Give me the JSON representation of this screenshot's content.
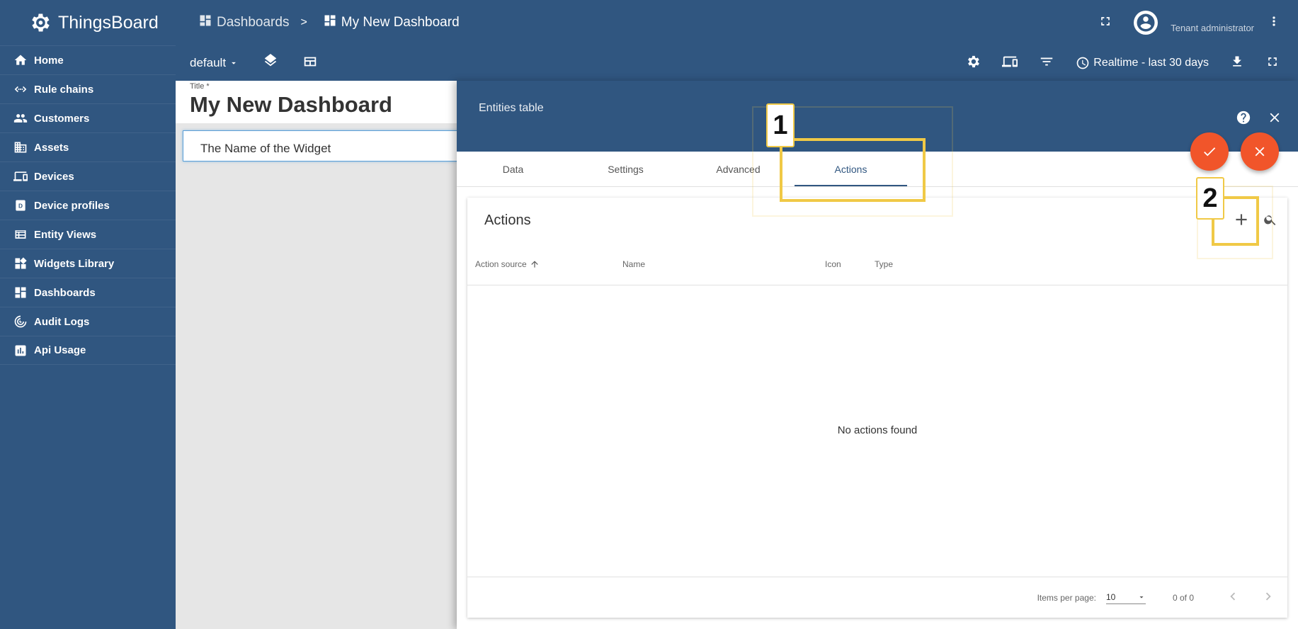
{
  "app": {
    "name": "ThingsBoard"
  },
  "sidebar": {
    "items": [
      {
        "label": "Home",
        "icon": "home-icon"
      },
      {
        "label": "Rule chains",
        "icon": "rule-chains-icon"
      },
      {
        "label": "Customers",
        "icon": "customers-icon"
      },
      {
        "label": "Assets",
        "icon": "assets-icon"
      },
      {
        "label": "Devices",
        "icon": "devices-icon"
      },
      {
        "label": "Device profiles",
        "icon": "device-profiles-icon"
      },
      {
        "label": "Entity Views",
        "icon": "entity-views-icon"
      },
      {
        "label": "Widgets Library",
        "icon": "widgets-library-icon"
      },
      {
        "label": "Dashboards",
        "icon": "dashboards-icon"
      },
      {
        "label": "Audit Logs",
        "icon": "audit-logs-icon"
      },
      {
        "label": "Api Usage",
        "icon": "api-usage-icon"
      }
    ]
  },
  "breadcrumb": {
    "parent": "Dashboards",
    "separator": ">",
    "current": "My New Dashboard"
  },
  "user": {
    "role": "Tenant administrator"
  },
  "toolbar": {
    "state": "default",
    "timewindow": "Realtime - last 30 days"
  },
  "dashboard": {
    "title_label": "Title *",
    "title": "My New Dashboard",
    "widget_name": "The Name of the Widget"
  },
  "editor": {
    "title": "Entities table",
    "tabs": [
      "Data",
      "Settings",
      "Advanced",
      "Actions"
    ],
    "active_tab": "Actions",
    "table_title": "Actions",
    "columns": [
      "Action source",
      "Name",
      "Icon",
      "Type"
    ],
    "empty_text": "No actions found",
    "paginator": {
      "items_label": "Items per page:",
      "page_size": "10",
      "range": "0 of 0"
    }
  },
  "callouts": [
    "1",
    "2"
  ],
  "colors": {
    "primary": "#305680",
    "accent": "#f1552a",
    "highlight": "#f0c946"
  }
}
